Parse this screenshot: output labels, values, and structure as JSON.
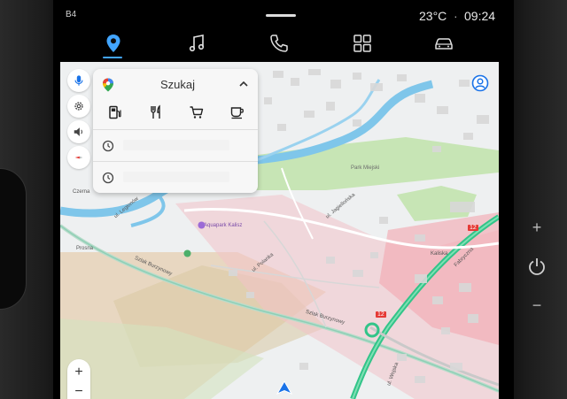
{
  "status_bar": {
    "left_label": "B4",
    "temperature": "23°C",
    "separator": "·",
    "time": "09:24"
  },
  "top_nav": {
    "items": [
      {
        "icon": "navigation-pin-icon",
        "active": true
      },
      {
        "icon": "music-note-icon",
        "active": false
      },
      {
        "icon": "phone-icon",
        "active": false
      },
      {
        "icon": "apps-grid-icon",
        "active": false
      },
      {
        "icon": "car-icon",
        "active": false
      }
    ],
    "accent": "#42a5ff"
  },
  "search_panel": {
    "label": "Szukaj",
    "categories": [
      "gas-station-icon",
      "restaurant-icon",
      "shopping-cart-icon",
      "coffee-icon"
    ]
  },
  "map": {
    "labels": {
      "aquapark": "Aquapark Kalisz",
      "park": "Park Miejski",
      "street_burzynowy": "Szlak Burzynowy",
      "street_burzynowy_2": "Szlak Burzynowy",
      "street_jagiellonska": "ul. Jagiellońska",
      "street_polanka": "ul. Polanka",
      "street_legionow": "ul. Legionów",
      "street_podlesie": "Czerna",
      "street_prosna": "Prosna",
      "street_fabryczna": "Fabryczna",
      "street_kaliska": "Kaliska",
      "street_wojska": "ul. Wojska",
      "road_12_a": "12",
      "road_12_b": "12"
    },
    "colors": {
      "water": "#7fc6ea",
      "park": "#c7e5b5",
      "traffic_green": "#32c489",
      "traffic_red": "#f3aab4"
    }
  },
  "zoom": {
    "in": "+",
    "out": "−"
  },
  "hardware": {
    "plus": "+",
    "minus": "−"
  }
}
